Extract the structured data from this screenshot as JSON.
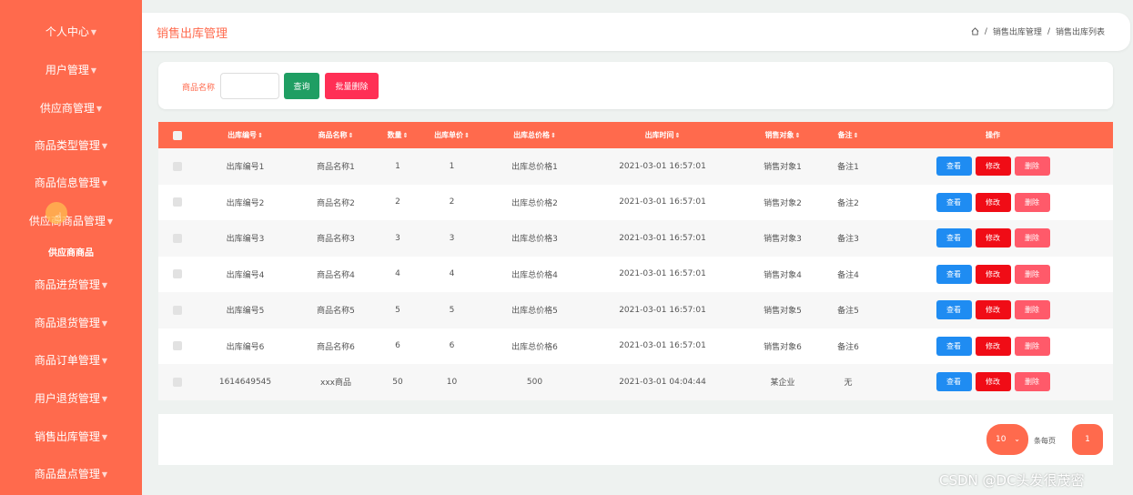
{
  "sidebar": {
    "items": [
      {
        "label": "个人中心"
      },
      {
        "label": "用户管理"
      },
      {
        "label": "供应商管理"
      },
      {
        "label": "商品类型管理"
      },
      {
        "label": "商品信息管理"
      },
      {
        "label": "供应商商品管理"
      },
      {
        "label": "商品进货管理"
      },
      {
        "label": "商品退货管理"
      },
      {
        "label": "商品订单管理"
      },
      {
        "label": "用户退货管理"
      },
      {
        "label": "销售出库管理"
      },
      {
        "label": "商品盘点管理"
      }
    ],
    "sub_item": "供应商商品",
    "arrow_icon": "triangle-down-icon",
    "color": "#ff6a4d"
  },
  "header": {
    "title": "销售出库管理",
    "breadcrumb": [
      "销售出库管理",
      "销售出库列表"
    ],
    "breadcrumb_sep": "/"
  },
  "search": {
    "label": "商品名称",
    "value": "",
    "placeholder": "",
    "query_label": "查询",
    "batch_delete_label": "批量删除"
  },
  "table": {
    "columns": [
      "出库编号",
      "商品名称",
      "数量",
      "出库单价",
      "出库总价格",
      "出库时间",
      "销售对象",
      "备注",
      "操作"
    ],
    "rows": [
      [
        "出库编号1",
        "商品名称1",
        "1",
        "1",
        "出库总价格1",
        "2021-03-01 16:57:01",
        "销售对象1",
        "备注1"
      ],
      [
        "出库编号2",
        "商品名称2",
        "2",
        "2",
        "出库总价格2",
        "2021-03-01 16:57:01",
        "销售对象2",
        "备注2"
      ],
      [
        "出库编号3",
        "商品名称3",
        "3",
        "3",
        "出库总价格3",
        "2021-03-01 16:57:01",
        "销售对象3",
        "备注3"
      ],
      [
        "出库编号4",
        "商品名称4",
        "4",
        "4",
        "出库总价格4",
        "2021-03-01 16:57:01",
        "销售对象4",
        "备注4"
      ],
      [
        "出库编号5",
        "商品名称5",
        "5",
        "5",
        "出库总价格5",
        "2021-03-01 16:57:01",
        "销售对象5",
        "备注5"
      ],
      [
        "出库编号6",
        "商品名称6",
        "6",
        "6",
        "出库总价格6",
        "2021-03-01 16:57:01",
        "销售对象6",
        "备注6"
      ],
      [
        "1614649545",
        "xxx商品",
        "50",
        "10",
        "500",
        "2021-03-01 04:04:44",
        "某企业",
        "无"
      ]
    ],
    "actions": {
      "view": "查看",
      "edit": "修改",
      "delete": "删除"
    },
    "colors": {
      "header": "#ff6a4d",
      "view": "#1f8cf2",
      "edit": "#f00c16",
      "delete": "#ff5a6a"
    }
  },
  "pager": {
    "page_size": "10",
    "per_page_label": "条每页",
    "current_page": "1"
  },
  "watermark": "CSDN @DC头发很茂密"
}
